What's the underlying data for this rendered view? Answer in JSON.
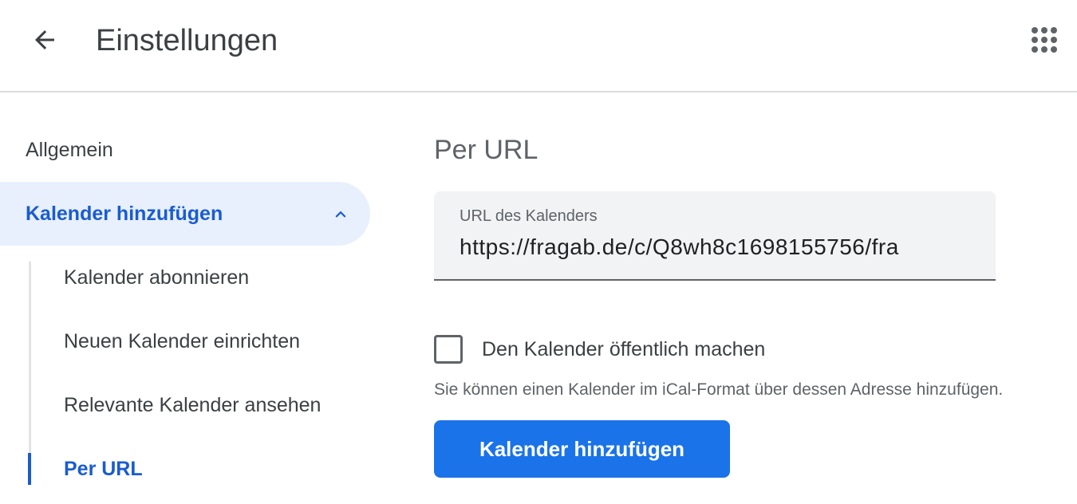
{
  "header": {
    "title": "Einstellungen",
    "back_icon": "arrow-back-icon",
    "apps_icon": "apps-grid-icon"
  },
  "sidebar": {
    "items": [
      {
        "label": "Allgemein",
        "active": false
      },
      {
        "label": "Kalender hinzufügen",
        "active": true,
        "expanded": true,
        "icon": "chevron-up-icon"
      }
    ],
    "sub_items": [
      {
        "label": "Kalender abonnieren",
        "active": false
      },
      {
        "label": "Neuen Kalender einrichten",
        "active": false
      },
      {
        "label": "Relevante Kalender ansehen",
        "active": false
      },
      {
        "label": "Per URL",
        "active": true
      }
    ]
  },
  "main": {
    "section_title": "Per URL",
    "url_field": {
      "label": "URL des Kalenders",
      "value": "https://fragab.de/c/Q8wh8c1698155756/fra"
    },
    "public_checkbox": {
      "label": "Den Kalender öffentlich machen",
      "checked": false
    },
    "hint": "Sie können einen Kalender im iCal-Format über dessen Adresse hinzufügen.",
    "submit_label": "Kalender hinzufügen"
  },
  "colors": {
    "accent": "#1a73e8",
    "active_text": "#1a5ccf",
    "active_bg": "#e8f0fe"
  }
}
